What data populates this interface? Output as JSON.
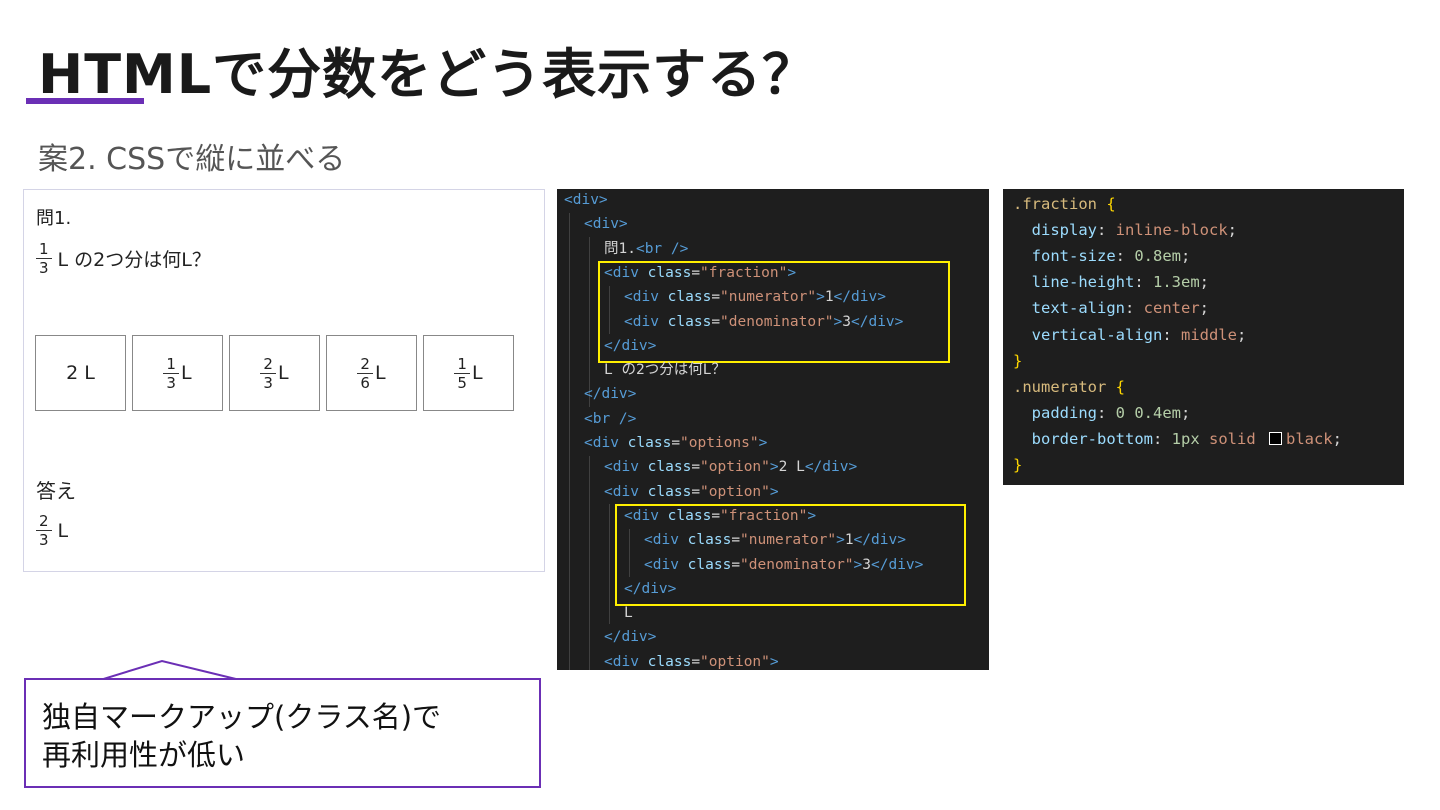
{
  "slide": {
    "title": "HTMLで分数をどう表示する？",
    "subtitle": "案2. CSSで縦に並べる",
    "accent_color": "#6b2fb5"
  },
  "preview": {
    "question_number": "問1.",
    "question": {
      "frac": {
        "num": "1",
        "den": "3"
      },
      "text": "L の2つ分は何L？"
    },
    "options": [
      {
        "text": "2 L"
      },
      {
        "frac": {
          "num": "1",
          "den": "3"
        },
        "unit": "L"
      },
      {
        "frac": {
          "num": "2",
          "den": "3"
        },
        "unit": "L"
      },
      {
        "frac": {
          "num": "2",
          "den": "6"
        },
        "unit": "L"
      },
      {
        "frac": {
          "num": "1",
          "den": "5"
        },
        "unit": "L"
      }
    ],
    "answer_label": "答え",
    "answer": {
      "frac": {
        "num": "2",
        "den": "3"
      },
      "unit": "L"
    }
  },
  "html_code": {
    "lines": [
      {
        "indent": 0,
        "tokens": [
          [
            "tag",
            "<div>"
          ]
        ]
      },
      {
        "indent": 1,
        "tokens": [
          [
            "tag",
            "<div>"
          ]
        ]
      },
      {
        "indent": 2,
        "tokens": [
          [
            "txt",
            "問1."
          ],
          [
            "tag",
            "<br />"
          ]
        ]
      },
      {
        "indent": 2,
        "tokens": [
          [
            "tag",
            "<div "
          ],
          [
            "attr",
            "class"
          ],
          [
            "txt",
            "="
          ],
          [
            "str",
            "\"fraction\""
          ],
          [
            "tag",
            ">"
          ]
        ]
      },
      {
        "indent": 3,
        "tokens": [
          [
            "tag",
            "<div "
          ],
          [
            "attr",
            "class"
          ],
          [
            "txt",
            "="
          ],
          [
            "str",
            "\"numerator\""
          ],
          [
            "tag",
            ">"
          ],
          [
            "txt",
            "1"
          ],
          [
            "tag",
            "</div>"
          ]
        ]
      },
      {
        "indent": 3,
        "tokens": [
          [
            "tag",
            "<div "
          ],
          [
            "attr",
            "class"
          ],
          [
            "txt",
            "="
          ],
          [
            "str",
            "\"denominator\""
          ],
          [
            "tag",
            ">"
          ],
          [
            "txt",
            "3"
          ],
          [
            "tag",
            "</div>"
          ]
        ]
      },
      {
        "indent": 2,
        "tokens": [
          [
            "tag",
            "</div>"
          ]
        ]
      },
      {
        "indent": 2,
        "tokens": [
          [
            "txt",
            "L の2つ分は何L？"
          ]
        ]
      },
      {
        "indent": 1,
        "tokens": [
          [
            "tag",
            "</div>"
          ]
        ]
      },
      {
        "indent": 1,
        "tokens": [
          [
            "tag",
            "<br />"
          ]
        ]
      },
      {
        "indent": 1,
        "tokens": [
          [
            "tag",
            "<div "
          ],
          [
            "attr",
            "class"
          ],
          [
            "txt",
            "="
          ],
          [
            "str",
            "\"options\""
          ],
          [
            "tag",
            ">"
          ]
        ]
      },
      {
        "indent": 2,
        "tokens": [
          [
            "tag",
            "<div "
          ],
          [
            "attr",
            "class"
          ],
          [
            "txt",
            "="
          ],
          [
            "str",
            "\"option\""
          ],
          [
            "tag",
            ">"
          ],
          [
            "txt",
            "2 L"
          ],
          [
            "tag",
            "</div>"
          ]
        ]
      },
      {
        "indent": 2,
        "tokens": [
          [
            "tag",
            "<div "
          ],
          [
            "attr",
            "class"
          ],
          [
            "txt",
            "="
          ],
          [
            "str",
            "\"option\""
          ],
          [
            "tag",
            ">"
          ]
        ]
      },
      {
        "indent": 3,
        "tokens": [
          [
            "tag",
            "<div "
          ],
          [
            "attr",
            "class"
          ],
          [
            "txt",
            "="
          ],
          [
            "str",
            "\"fraction\""
          ],
          [
            "tag",
            ">"
          ]
        ]
      },
      {
        "indent": 4,
        "tokens": [
          [
            "tag",
            "<div "
          ],
          [
            "attr",
            "class"
          ],
          [
            "txt",
            "="
          ],
          [
            "str",
            "\"numerator\""
          ],
          [
            "tag",
            ">"
          ],
          [
            "txt",
            "1"
          ],
          [
            "tag",
            "</div>"
          ]
        ]
      },
      {
        "indent": 4,
        "tokens": [
          [
            "tag",
            "<div "
          ],
          [
            "attr",
            "class"
          ],
          [
            "txt",
            "="
          ],
          [
            "str",
            "\"denominator\""
          ],
          [
            "tag",
            ">"
          ],
          [
            "txt",
            "3"
          ],
          [
            "tag",
            "</div>"
          ]
        ]
      },
      {
        "indent": 3,
        "tokens": [
          [
            "tag",
            "</div>"
          ]
        ]
      },
      {
        "indent": 3,
        "tokens": [
          [
            "txt",
            "L"
          ]
        ]
      },
      {
        "indent": 2,
        "tokens": [
          [
            "tag",
            "</div>"
          ]
        ]
      },
      {
        "indent": 2,
        "tokens": [
          [
            "tag",
            "<div "
          ],
          [
            "attr",
            "class"
          ],
          [
            "txt",
            "="
          ],
          [
            "str",
            "\"option\""
          ],
          [
            "tag",
            ">"
          ]
        ]
      }
    ],
    "highlight_color": "#ffef00"
  },
  "css_code": {
    "lines": [
      [
        [
          "sel",
          ".fraction "
        ],
        [
          "brace",
          "{"
        ]
      ],
      [
        [
          "prop",
          "  display"
        ],
        [
          "punc",
          ": "
        ],
        [
          "val",
          "inline-block"
        ],
        [
          "punc",
          ";"
        ]
      ],
      [
        [
          "prop",
          "  font-size"
        ],
        [
          "punc",
          ": "
        ],
        [
          "numv",
          "0.8em"
        ],
        [
          "punc",
          ";"
        ]
      ],
      [
        [
          "prop",
          "  line-height"
        ],
        [
          "punc",
          ": "
        ],
        [
          "numv",
          "1.3em"
        ],
        [
          "punc",
          ";"
        ]
      ],
      [
        [
          "prop",
          "  text-align"
        ],
        [
          "punc",
          ": "
        ],
        [
          "val",
          "center"
        ],
        [
          "punc",
          ";"
        ]
      ],
      [
        [
          "prop",
          "  vertical-align"
        ],
        [
          "punc",
          ": "
        ],
        [
          "val",
          "middle"
        ],
        [
          "punc",
          ";"
        ]
      ],
      [
        [
          "brace",
          "}"
        ]
      ],
      [
        [
          "sel",
          ".numerator "
        ],
        [
          "brace",
          "{"
        ]
      ],
      [
        [
          "prop",
          "  padding"
        ],
        [
          "punc",
          ": "
        ],
        [
          "numv",
          "0 0.4em"
        ],
        [
          "punc",
          ";"
        ]
      ],
      [
        [
          "prop",
          "  border-bottom"
        ],
        [
          "punc",
          ": "
        ],
        [
          "numv",
          "1px"
        ],
        [
          "val",
          " solid "
        ],
        [
          "swatch",
          ""
        ],
        [
          "val",
          "black"
        ],
        [
          "punc",
          ";"
        ]
      ],
      [
        [
          "brace",
          "}"
        ]
      ]
    ]
  },
  "callout": {
    "text": "独自マークアップ(クラス名)で\n再利用性が低い"
  }
}
